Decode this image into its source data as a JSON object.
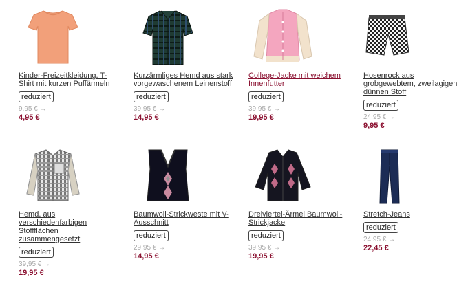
{
  "products": [
    {
      "name": "Kinder-Freizeitkleidung, T-Shirt mit kurzen Puffärmeln",
      "badge": "reduziert",
      "old_price": "9,95 € →",
      "new_price": "4,95 €",
      "icon": "tshirt-icon"
    },
    {
      "name": "Kurzärmliges Hemd aus stark vorgewaschenem Leinenstoff",
      "badge": "reduziert",
      "old_price": "39,95 € →",
      "new_price": "14,95 €",
      "icon": "shirt-icon"
    },
    {
      "name": "College-Jacke mit weichem Innenfutter",
      "badge": "reduziert",
      "old_price": "39,95 € →",
      "new_price": "19,95 €",
      "icon": "jacket-icon"
    },
    {
      "name": "Hosenrock aus grobgewebtem, zweilagigen dünnen Stoff",
      "badge": "reduziert",
      "old_price": "24,95 € →",
      "new_price": "9,95 €",
      "icon": "skirt-shorts-icon"
    },
    {
      "name": "Hemd, aus verschiedenfarbigen Stoffflächen zusammengesetzt",
      "badge": "reduziert",
      "old_price": "39,95 € →",
      "new_price": "19,95 €",
      "icon": "shirt-icon"
    },
    {
      "name": "Baumwoll-Strickweste mit V-Ausschnitt",
      "badge": "reduziert",
      "old_price": "29,95 € →",
      "new_price": "14,95 €",
      "icon": "vest-icon"
    },
    {
      "name": "Dreiviertel-Ärmel Baumwoll-Strickjacke",
      "badge": "reduziert",
      "old_price": "39,95 € →",
      "new_price": "19,95 €",
      "icon": "cardigan-icon"
    },
    {
      "name": "Stretch-Jeans",
      "badge": "reduziert",
      "old_price": "24,95 € →",
      "new_price": "22,45 €",
      "icon": "jeans-icon"
    }
  ],
  "colors": {
    "accent": "#8b1030",
    "old_price": "#aaaaaa"
  }
}
